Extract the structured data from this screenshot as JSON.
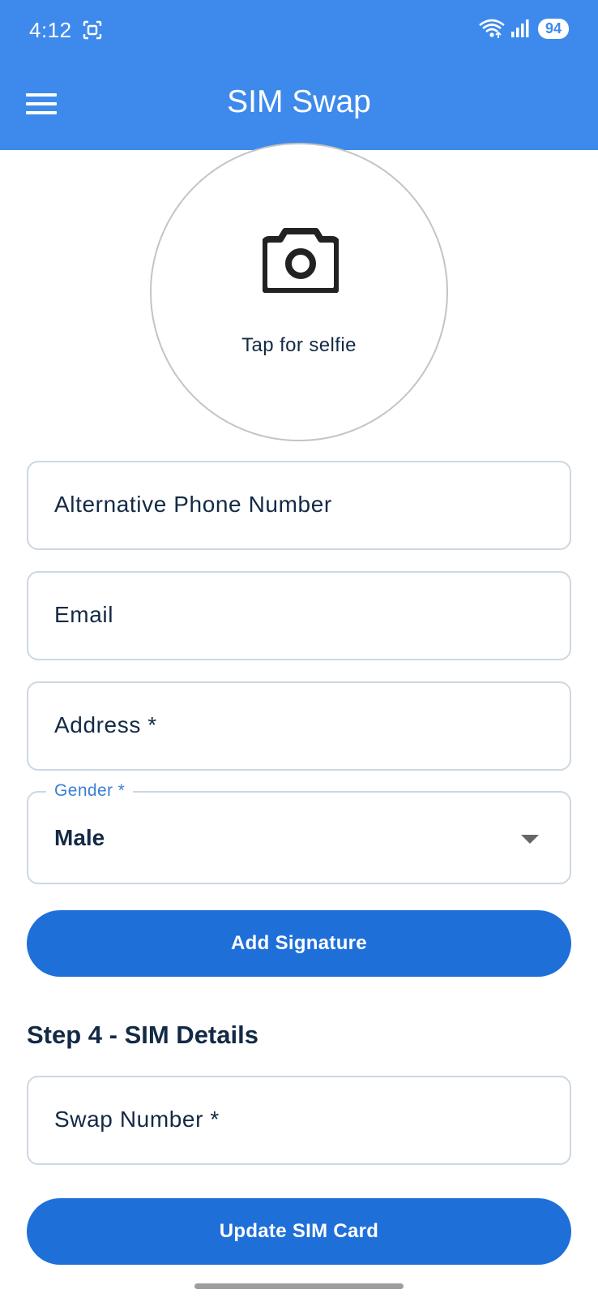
{
  "status_bar": {
    "time": "4:12",
    "battery": "94"
  },
  "app_bar": {
    "title": "SIM Swap"
  },
  "selfie": {
    "caption": "Tap for selfie"
  },
  "form": {
    "alt_phone_label": "Alternative Phone Number",
    "email_label": "Email",
    "address_label": "Address *",
    "gender": {
      "label": "Gender *",
      "value": "Male"
    },
    "add_signature_label": "Add Signature"
  },
  "step4": {
    "heading": "Step 4 - SIM Details",
    "swap_number_label": "Swap Number *",
    "update_button_label": "Update SIM Card"
  },
  "colors": {
    "app_bar": "#3d8aec",
    "primary_button": "#1f6fd9",
    "accent_label": "#3b7fd4"
  }
}
